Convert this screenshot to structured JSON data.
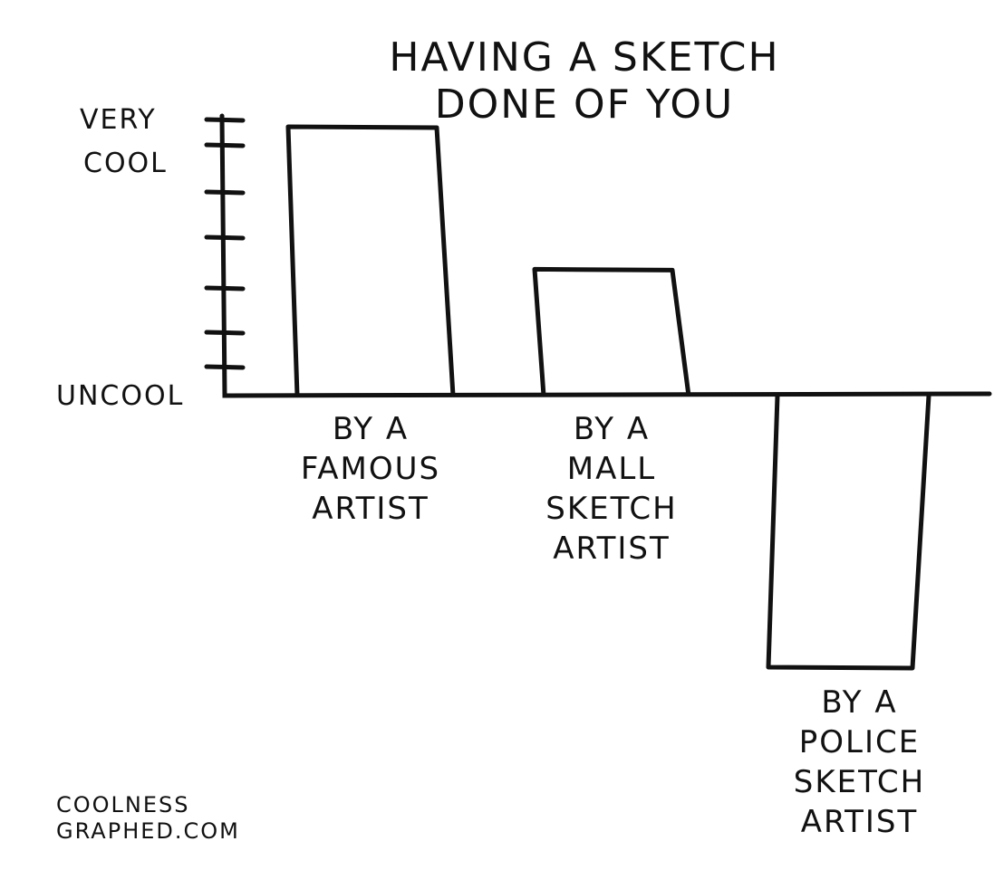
{
  "chart_data": {
    "type": "bar",
    "title": [
      "HAVING A SKETCH",
      "DONE OF YOU"
    ],
    "xlabel": "",
    "ylabel": "",
    "y_tick_labels": {
      "top": [
        "VERY",
        "COOL"
      ],
      "bottom": "UNCOOL"
    },
    "ylim": [
      -10.5,
      10.5
    ],
    "categories": [
      [
        "BY A",
        "FAMOUS",
        "ARTIST"
      ],
      [
        "BY A",
        "MALL",
        "SKETCH",
        "ARTIST"
      ],
      [
        "BY A",
        "POLICE",
        "SKETCH",
        "ARTIST"
      ]
    ],
    "values": [
      10,
      4.7,
      -10.1
    ],
    "grid": false,
    "watermark": [
      "COOLNESS",
      "GRAPHED.COM"
    ],
    "colors": {
      "ink": "#111111",
      "background": "#ffffff"
    }
  }
}
